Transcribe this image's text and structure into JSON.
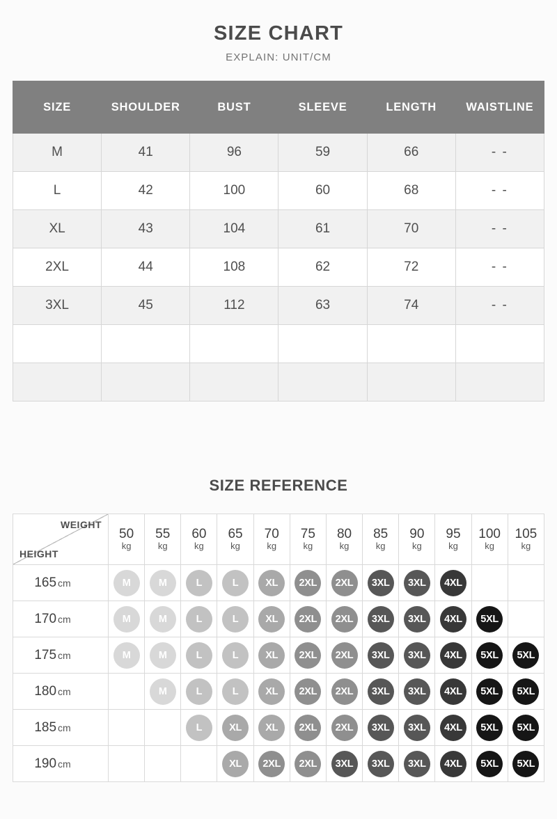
{
  "size_chart": {
    "title": "SIZE CHART",
    "subtitle": "EXPLAIN: UNIT/CM",
    "columns": [
      "SIZE",
      "SHOULDER",
      "BUST",
      "SLEEVE",
      "LENGTH",
      "WAISTLINE"
    ],
    "rows": [
      [
        "M",
        "41",
        "96",
        "59",
        "66",
        "- -"
      ],
      [
        "L",
        "42",
        "100",
        "60",
        "68",
        "- -"
      ],
      [
        "XL",
        "43",
        "104",
        "61",
        "70",
        "- -"
      ],
      [
        "2XL",
        "44",
        "108",
        "62",
        "72",
        "- -"
      ],
      [
        "3XL",
        "45",
        "112",
        "63",
        "74",
        "- -"
      ],
      [
        "",
        "",
        "",
        "",
        "",
        ""
      ],
      [
        "",
        "",
        "",
        "",
        "",
        ""
      ]
    ]
  },
  "size_reference": {
    "title": "SIZE REFERENCE",
    "weight_label": "WEIGHT",
    "height_label": "HEIGHT",
    "weight_unit": "kg",
    "height_unit": "cm",
    "weights": [
      "50",
      "55",
      "60",
      "65",
      "70",
      "75",
      "80",
      "85",
      "90",
      "95",
      "100",
      "105"
    ],
    "heights": [
      "165",
      "170",
      "175",
      "180",
      "185",
      "190"
    ],
    "matrix": [
      [
        "M",
        "M",
        "L",
        "L",
        "XL",
        "2XL",
        "2XL",
        "3XL",
        "3XL",
        "4XL",
        "",
        ""
      ],
      [
        "M",
        "M",
        "L",
        "L",
        "XL",
        "2XL",
        "2XL",
        "3XL",
        "3XL",
        "4XL",
        "5XL",
        ""
      ],
      [
        "M",
        "M",
        "L",
        "L",
        "XL",
        "2XL",
        "2XL",
        "3XL",
        "3XL",
        "4XL",
        "5XL",
        "5XL"
      ],
      [
        "",
        "M",
        "L",
        "L",
        "XL",
        "2XL",
        "2XL",
        "3XL",
        "3XL",
        "4XL",
        "5XL",
        "5XL"
      ],
      [
        "",
        "",
        "L",
        "XL",
        "XL",
        "2XL",
        "2XL",
        "3XL",
        "3XL",
        "4XL",
        "5XL",
        "5XL"
      ],
      [
        "",
        "",
        "",
        "XL",
        "2XL",
        "2XL",
        "3XL",
        "3XL",
        "3XL",
        "4XL",
        "5XL",
        "5XL"
      ]
    ],
    "colors": {
      "M": "#d8d8d8",
      "L": "#c2c2c2",
      "XL": "#a9a9a9",
      "2XL": "#8f8f8f",
      "3XL": "#575757",
      "4XL": "#383838",
      "5XL": "#161616"
    }
  },
  "theme": {
    "header_bg": "#808080",
    "row_alt_bg": "#f1f1f1",
    "border": "#d6d6d6",
    "text": "#4a4a4a",
    "page_bg": "#fbfbfb"
  }
}
